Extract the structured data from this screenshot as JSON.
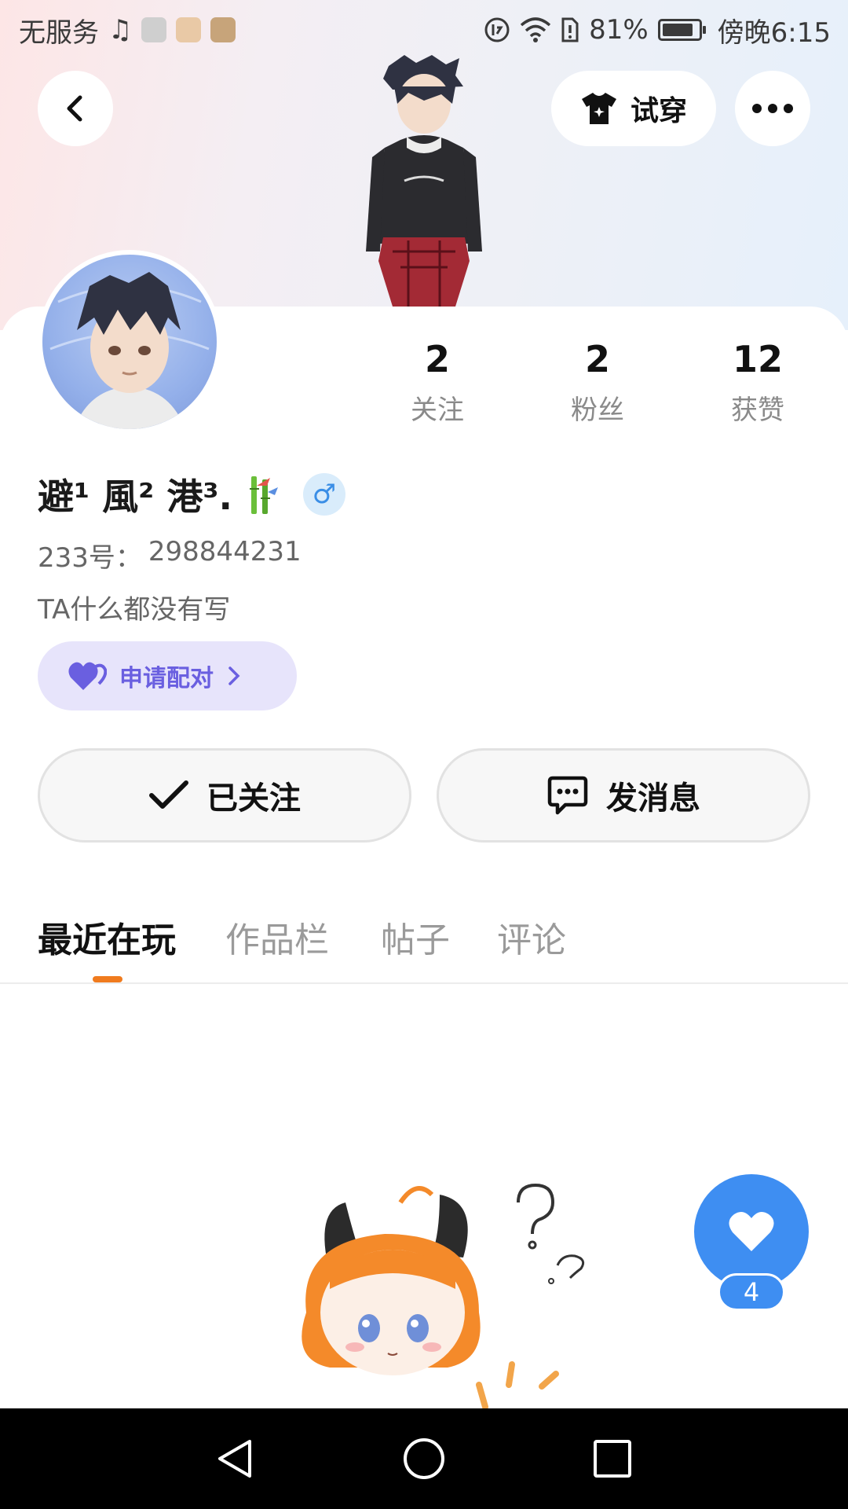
{
  "status_bar": {
    "carrier": "无服务",
    "battery_percent": "81%",
    "time": "傍晚6:15"
  },
  "header": {
    "try_on_label": "试穿"
  },
  "stats": [
    {
      "value": "2",
      "label": "关注"
    },
    {
      "value": "2",
      "label": "粉丝"
    },
    {
      "value": "12",
      "label": "获赞"
    }
  ],
  "profile": {
    "username": "避¹ 風² 港³.",
    "gender_symbol": "♂",
    "id_label": "233号：",
    "id_value": "298844231",
    "bio": "TA什么都没有写",
    "pair_label": "申请配对"
  },
  "actions": {
    "follow_label": "已关注",
    "message_label": "发消息"
  },
  "tabs": [
    {
      "label": "最近在玩",
      "active": true
    },
    {
      "label": "作品栏",
      "active": false
    },
    {
      "label": "帖子",
      "active": false
    },
    {
      "label": "评论",
      "active": false
    }
  ],
  "like_fab": {
    "count": "4"
  },
  "colors": {
    "accent_orange": "#f07b1e",
    "like_blue": "#3e8ef2",
    "pair_purple": "#6a5fe0"
  }
}
